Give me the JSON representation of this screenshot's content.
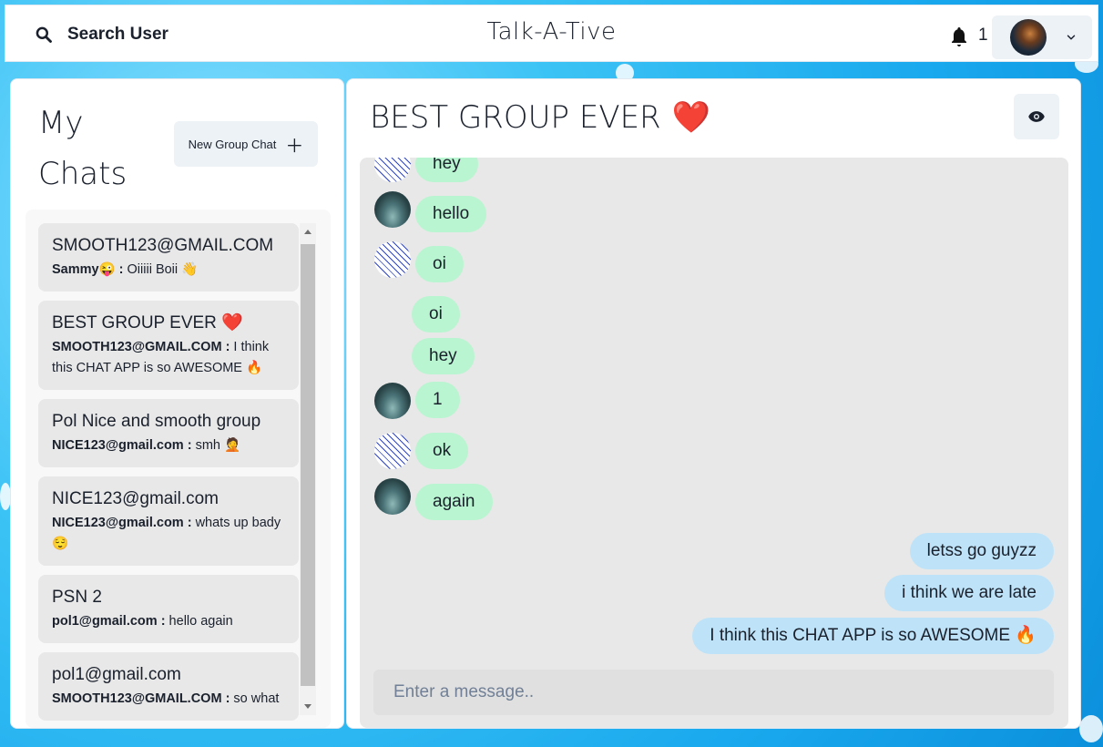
{
  "topbar": {
    "search_label": "Search User",
    "app_title": "Talk-A-Tive",
    "notification_count": "1"
  },
  "chats": {
    "title": "My Chats",
    "new_group_label": "New Group Chat",
    "items": [
      {
        "name": "SMOOTH123@GMAIL.COM",
        "sender": "Sammy😜 :",
        "message": " Oiiiii Boii 👋"
      },
      {
        "name": "BEST GROUP EVER ❤️",
        "sender": "SMOOTH123@GMAIL.COM :",
        "message": " I think this CHAT APP is so AWESOME 🔥"
      },
      {
        "name": "Pol Nice and smooth group",
        "sender": "NICE123@gmail.com :",
        "message": " smh 🤦"
      },
      {
        "name": "NICE123@gmail.com",
        "sender": "NICE123@gmail.com :",
        "message": " whats up bady 😌"
      },
      {
        "name": "PSN 2",
        "sender": "pol1@gmail.com :",
        "message": " hello again"
      },
      {
        "name": "pol1@gmail.com",
        "sender": "SMOOTH123@GMAIL.COM :",
        "message": " so what"
      }
    ]
  },
  "conversation": {
    "title": "BEST GROUP EVER",
    "title_emoji": "❤️",
    "messages": [
      {
        "text": "hey",
        "from": "other",
        "avatar": "scribble"
      },
      {
        "text": "hello",
        "from": "other",
        "avatar": "lake"
      },
      {
        "text": "oi",
        "from": "other",
        "avatar": "scribble"
      },
      {
        "text": "oi",
        "from": "other",
        "avatar": "none"
      },
      {
        "text": "hey",
        "from": "other",
        "avatar": "none"
      },
      {
        "text": "1",
        "from": "other",
        "avatar": "lake"
      },
      {
        "text": "ok",
        "from": "other",
        "avatar": "scribble"
      },
      {
        "text": "again",
        "from": "other",
        "avatar": "lake"
      },
      {
        "text": "letss go guyzz",
        "from": "me"
      },
      {
        "text": "i think we are late",
        "from": "me"
      },
      {
        "text": "I think this CHAT APP is so AWESOME 🔥",
        "from": "me"
      }
    ],
    "input_placeholder": "Enter a message.."
  },
  "colors": {
    "other_bubble": "#b9f5d0",
    "my_bubble": "#bee3f8",
    "background": "#1aa9ee"
  }
}
